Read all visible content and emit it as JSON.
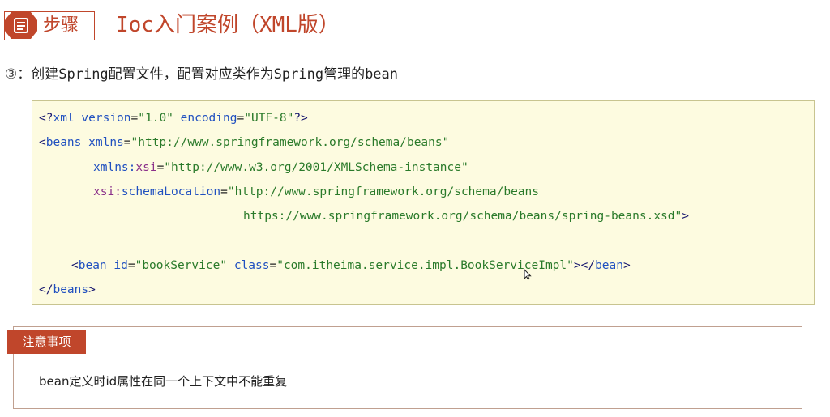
{
  "header": {
    "step_label": "步骤",
    "title": "Ioc入门案例（XML版）",
    "step_icon": "document-icon",
    "accent_color": "#c0462b"
  },
  "instruction": {
    "number": "③",
    "text": "：创建Spring配置文件，配置对应类作为Spring管理的bean"
  },
  "code": {
    "line1": {
      "open": "<?",
      "tag": "xml",
      "attr1": "version",
      "val1": "\"1.0\"",
      "attr2": "encoding",
      "val2": "\"UTF-8\"",
      "close": "?>"
    },
    "line2": {
      "open": "<",
      "tag": "beans",
      "attr": "xmlns",
      "val": "\"http://www.springframework.org/schema/beans\""
    },
    "line3": {
      "ns": "xmlns:",
      "attr": "xsi",
      "val": "\"http://www.w3.org/2001/XMLSchema-instance\""
    },
    "line4": {
      "ns": "xsi:",
      "attr": "schemaLocation",
      "val": "\"http://www.springframework.org/schema/beans"
    },
    "line5": {
      "val": "https://www.springframework.org/schema/beans/spring-beans.xsd\"",
      "close": ">"
    },
    "line6": {
      "open": "<",
      "tag": "bean",
      "attr1": "id",
      "val1": "\"bookService\"",
      "attr2": "class",
      "val2": "\"com.itheima.service.impl.BookServiceImpl\"",
      "mid": "></",
      "tag_end": "bean",
      "close": ">"
    },
    "line7": {
      "open": "</",
      "tag": "beans",
      "close": ">"
    }
  },
  "notice": {
    "label": "注意事项",
    "text": "bean定义时id属性在同一个上下文中不能重复"
  }
}
